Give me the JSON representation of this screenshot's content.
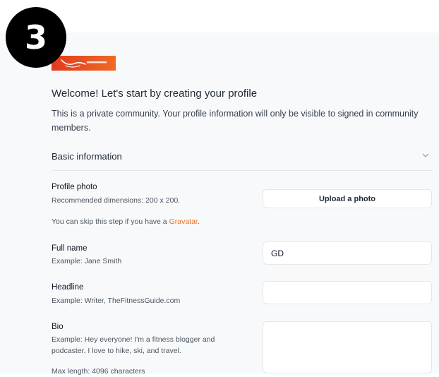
{
  "step_badge": "3",
  "intro": {
    "title": "Welcome! Let's start by creating your profile",
    "description": "This is a private community. Your profile information will only be visible to signed in community members."
  },
  "section": {
    "title": "Basic information"
  },
  "profile_photo": {
    "label": "Profile photo",
    "dimensions_hint": "Recommended dimensions: 200 x 200.",
    "upload_label": "Upload a photo",
    "skip_hint_prefix": "You can skip this step if you have a ",
    "gravatar_link": "Gravatar",
    "skip_hint_suffix": "."
  },
  "full_name": {
    "label": "Full name",
    "example": "Example: Jane Smith",
    "value": "GD"
  },
  "headline": {
    "label": "Headline",
    "example": "Example: Writer, TheFitnessGuide.com",
    "value": ""
  },
  "bio": {
    "label": "Bio",
    "example": "Example: Hey everyone! I'm a fitness blogger and podcaster. I love to hike, ski, and travel.",
    "max_length": "Max length: 4096 characters",
    "value": ""
  },
  "colors": {
    "accent": "#e8742a",
    "logo_red": "#e03a1e",
    "logo_orange": "#f06a26",
    "panel_bg": "#f8f9fa"
  },
  "icons": {
    "section_toggle": "chevron-down-icon"
  }
}
